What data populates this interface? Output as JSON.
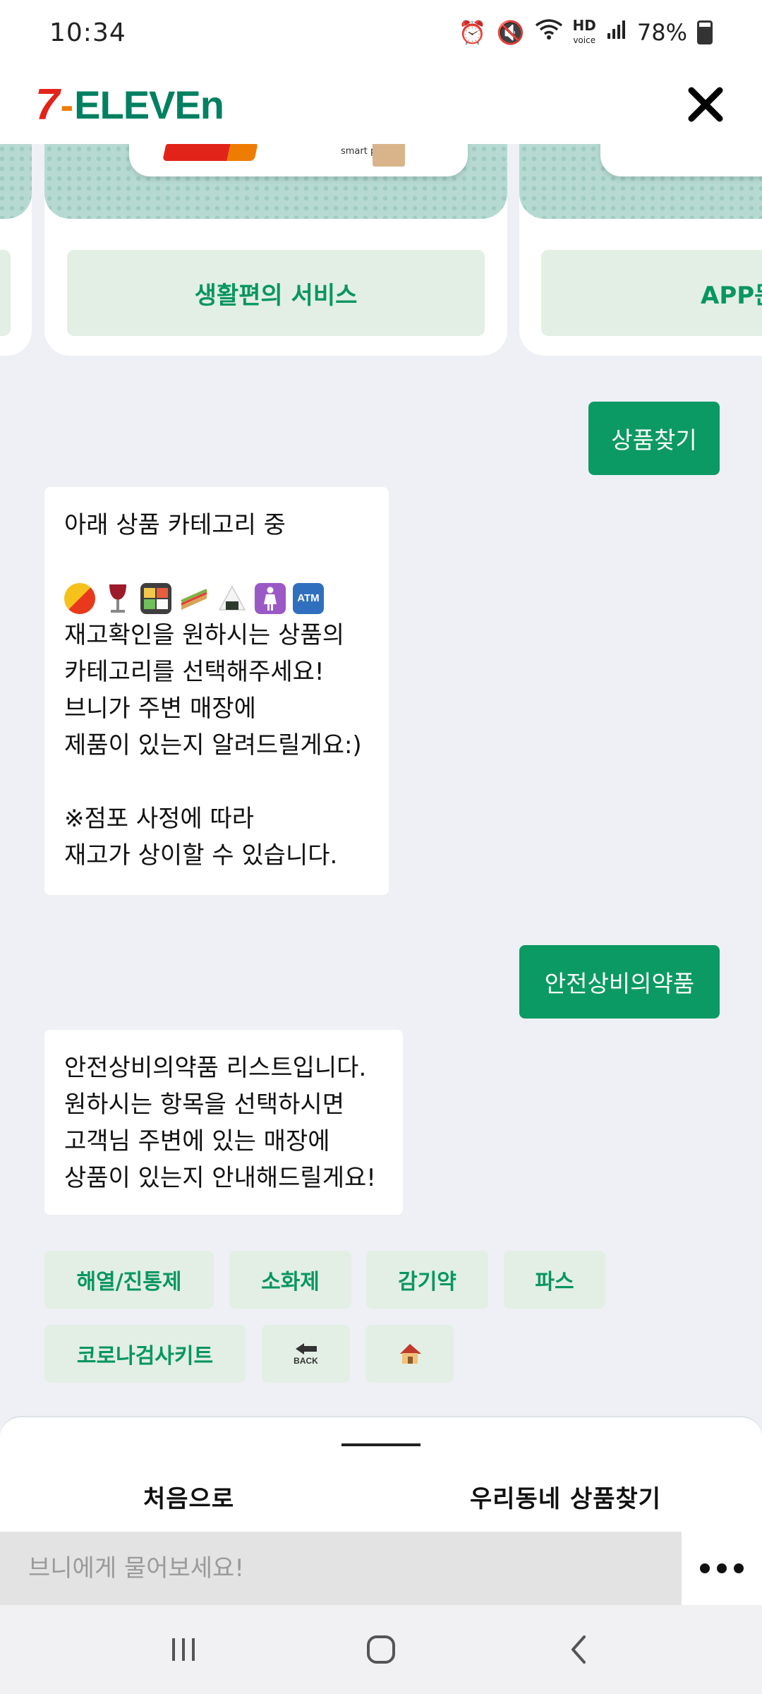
{
  "status_bar": {
    "time": "10:34",
    "hd_label": "HD",
    "voice_label": "voice",
    "battery": "78%",
    "battery_level": 0.78
  },
  "header": {
    "logo_seven": "7",
    "logo_dash": "-",
    "logo_word": "ELEVEn",
    "close_icon": "close-icon"
  },
  "carousel": {
    "cards": [
      {
        "button_label": "생활편의 서비스",
        "banner_text": "smart pick"
      },
      {
        "button_label": "APP문"
      }
    ]
  },
  "chat": {
    "user_msg_1": "상품찾기",
    "bot_msg_1": {
      "line1": "아래 상품 카테고리 중",
      "emojis": [
        "pill-icon",
        "wine-glass-icon",
        "bento-box-icon",
        "sandwich-icon",
        "rice-ball-icon",
        "woman-symbol-icon",
        "atm-icon"
      ],
      "atm_label": "ATM",
      "line2": "재고확인을 원하시는 상품의",
      "line3": "카테고리를 선택해주세요!",
      "line4": "브니가 주변 매장에",
      "line5": "제품이 있는지 알려드릴게요:)",
      "line6": "※점포 사정에 따라",
      "line7": "재고가 상이할 수 있습니다."
    },
    "user_msg_2": "안전상비의약품",
    "bot_msg_2": {
      "line1": "안전상비의약품 리스트입니다.",
      "line2": "원하시는 항목을 선택하시면",
      "line3": "고객님 주변에 있는 매장에",
      "line4": "상품이 있는지 안내해드릴게요!"
    },
    "quick_replies": [
      "해열/진통제",
      "소화제",
      "감기약",
      "파스",
      "코로나검사키트"
    ],
    "back_label": "BACK"
  },
  "bottom_sheet": {
    "home_label": "처음으로",
    "find_label": "우리동네 상품찾기"
  },
  "input": {
    "placeholder": "브니에게 물어보세요!"
  },
  "colors": {
    "brand_green": "#0b9a63",
    "chip_bg": "#e3efe4",
    "brand_red": "#e2231a",
    "brand_orange": "#ee7c00",
    "chat_bg": "#eef0f5"
  }
}
